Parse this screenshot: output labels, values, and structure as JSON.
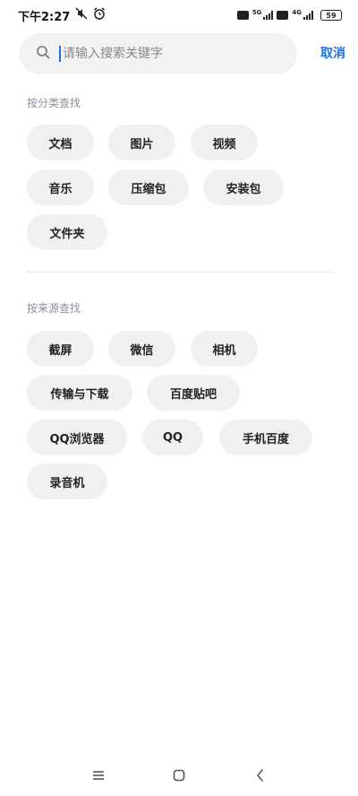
{
  "status_bar": {
    "time": "下午2:27",
    "battery": "59",
    "network_1": "5G",
    "network_2": "4G"
  },
  "search": {
    "placeholder": "请输入搜索关键字",
    "cancel_label": "取消"
  },
  "by_category": {
    "title": "按分类查找",
    "items": [
      "文档",
      "图片",
      "视频",
      "音乐",
      "压缩包",
      "安装包",
      "文件夹"
    ]
  },
  "by_source": {
    "title": "按来源查找",
    "items": [
      "截屏",
      "微信",
      "相机",
      "传输与下载",
      "百度贴吧",
      "QQ浏览器",
      "QQ",
      "手机百度",
      "录音机"
    ]
  },
  "icons": {
    "search": "search-icon",
    "alarm": "alarm-icon",
    "mute": "mute-icon",
    "nav_menu": "menu-icon",
    "nav_home": "home-icon",
    "nav_back": "back-icon"
  },
  "colors": {
    "accent": "#1a73e8",
    "chip_bg": "#f0f0f0",
    "section_title": "#8a8f9c"
  }
}
